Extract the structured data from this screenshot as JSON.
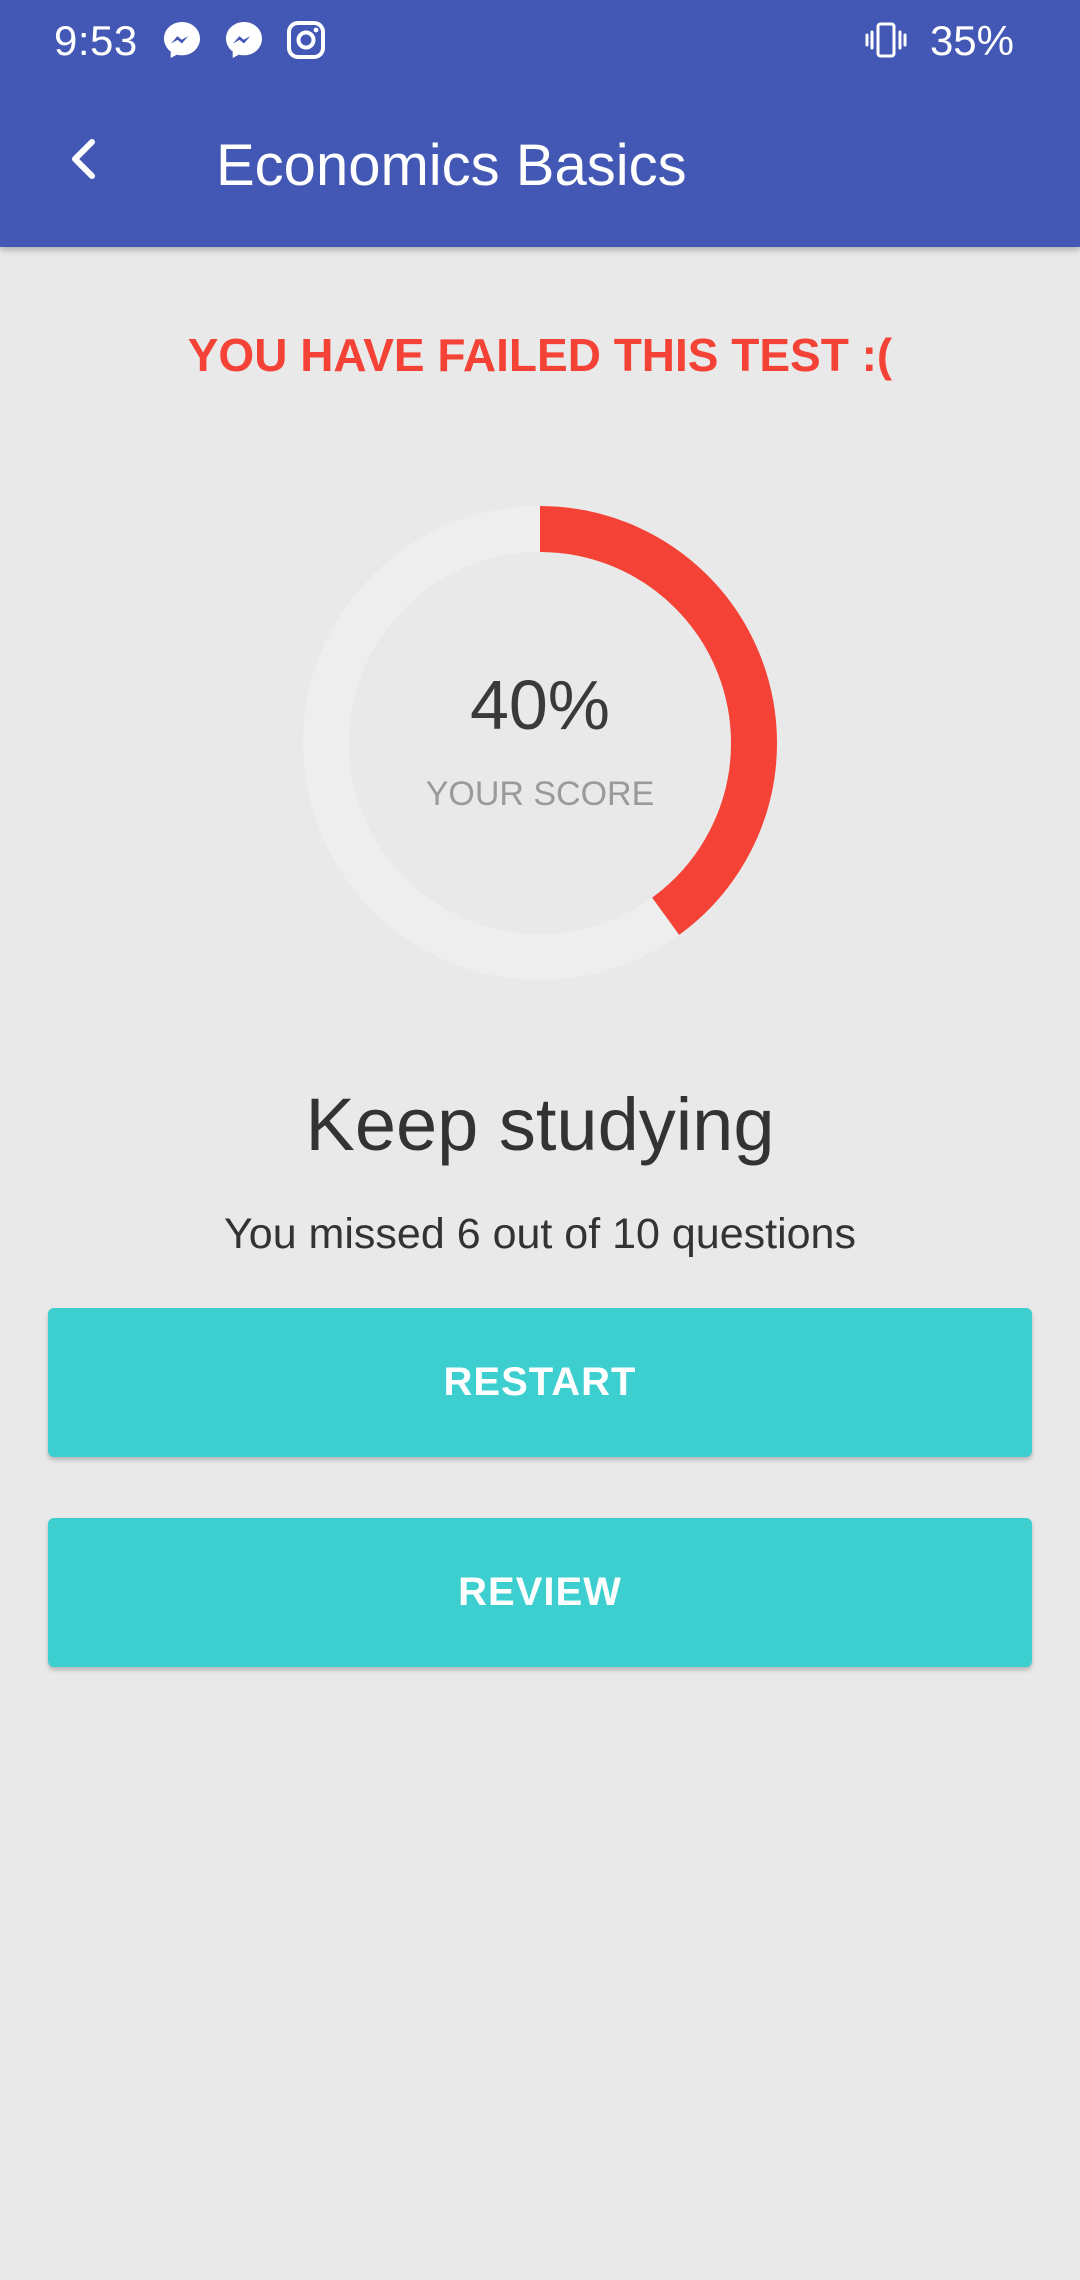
{
  "status_bar": {
    "time": "9:53",
    "notification_icons": [
      "messenger-icon",
      "messenger-icon",
      "instagram-icon"
    ],
    "vibrate_icon": "vibrate-icon",
    "battery": "35%"
  },
  "toolbar": {
    "back_icon": "chevron-left-icon",
    "title": "Economics Basics"
  },
  "result": {
    "banner": "YOU HAVE FAILED THIS TEST :(",
    "score": "40%",
    "score_fraction": 0.4,
    "score_label": "YOUR SCORE",
    "heading": "Keep studying",
    "summary": "You missed 6 out of 10 questions"
  },
  "actions": {
    "restart_label": "RESTART",
    "review_label": "REVIEW"
  },
  "colors": {
    "app_bar": "#4358b4",
    "fail_red": "#f44336",
    "accent_teal": "#3dcfcf",
    "background": "#e9e9e9"
  }
}
